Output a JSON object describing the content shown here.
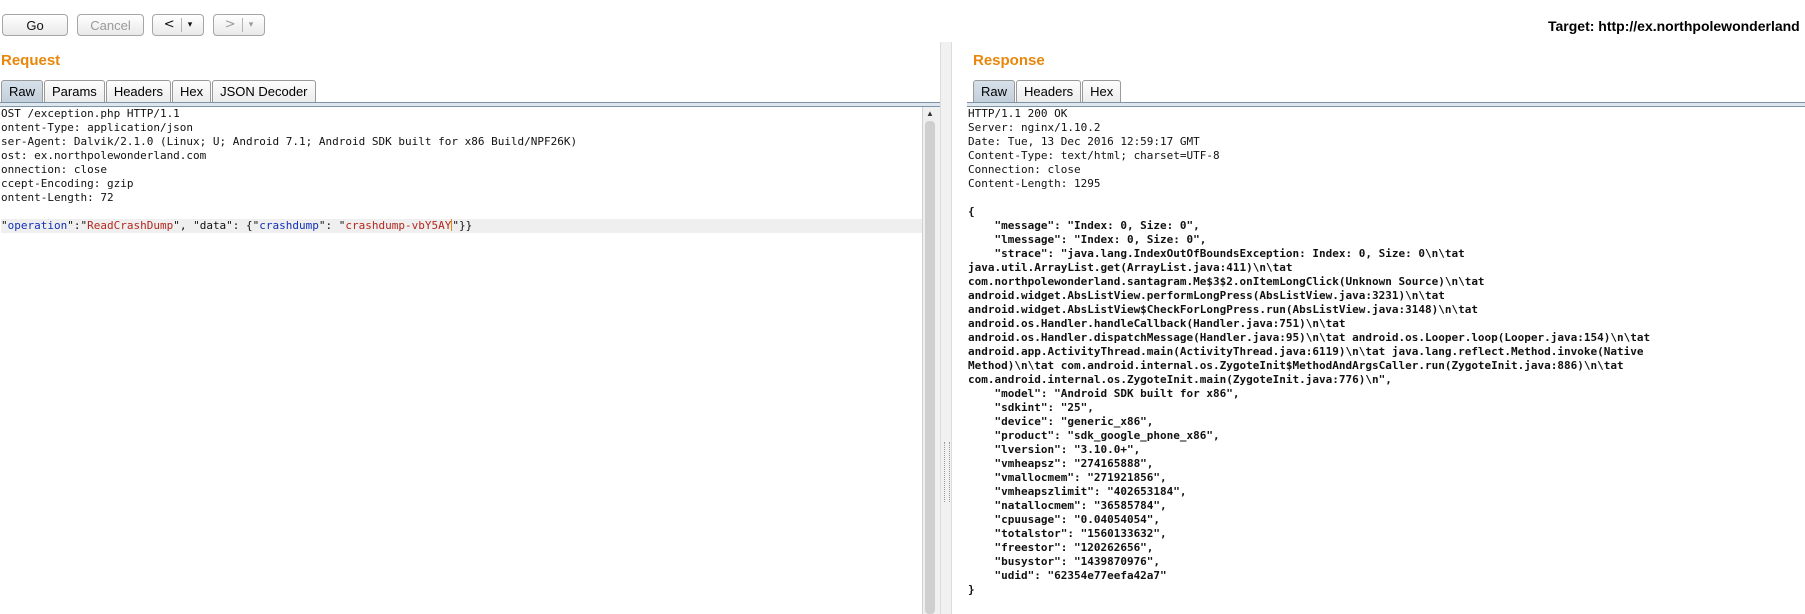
{
  "toolbar": {
    "go": "Go",
    "cancel": "Cancel",
    "prev": "<",
    "next": ">",
    "dropdown": "▾",
    "target": "Target: http://ex.northpolewonderland"
  },
  "request": {
    "title": "Request",
    "tabs": [
      "Raw",
      "Params",
      "Headers",
      "Hex",
      "JSON Decoder"
    ],
    "active_tab": "Raw",
    "lines": [
      "OST /exception.php HTTP/1.1",
      "ontent-Type: application/json",
      "ser-Agent: Dalvik/2.1.0 (Linux; U; Android 7.1; Android SDK built for x86 Build/NPF26K)",
      "ost: ex.northpolewonderland.com",
      "onnection: close",
      "ccept-Encoding: gzip",
      "ontent-Length: 72",
      ""
    ],
    "body": {
      "q1": "\"",
      "k1": "operation",
      "s1": "\":\"",
      "v1": "ReadCrashDump",
      "s2": "\", \"data\": {\"",
      "k2": "crashdump",
      "s3": "\": \"",
      "v2": "crashdump-vbY5AY",
      "s4": "\"}}"
    }
  },
  "response": {
    "title": "Response",
    "tabs": [
      "Raw",
      "Headers",
      "Hex"
    ],
    "active_tab": "Raw",
    "headers": [
      "HTTP/1.1 200 OK",
      "Server: nginx/1.10.2",
      "Date: Tue, 13 Dec 2016 12:59:17 GMT",
      "Content-Type: text/html; charset=UTF-8",
      "Connection: close",
      "Content-Length: 1295",
      ""
    ],
    "body_lines": [
      "{",
      "    \"message\": \"Index: 0, Size: 0\",",
      "    \"lmessage\": \"Index: 0, Size: 0\",",
      "    \"strace\": \"java.lang.IndexOutOfBoundsException: Index: 0, Size: 0\\n\\tat",
      "java.util.ArrayList.get(ArrayList.java:411)\\n\\tat",
      "com.northpolewonderland.santagram.Me$3$2.onItemLongClick(Unknown Source)\\n\\tat",
      "android.widget.AbsListView.performLongPress(AbsListView.java:3231)\\n\\tat",
      "android.widget.AbsListView$CheckForLongPress.run(AbsListView.java:3148)\\n\\tat",
      "android.os.Handler.handleCallback(Handler.java:751)\\n\\tat",
      "android.os.Handler.dispatchMessage(Handler.java:95)\\n\\tat android.os.Looper.loop(Looper.java:154)\\n\\tat",
      "android.app.ActivityThread.main(ActivityThread.java:6119)\\n\\tat java.lang.reflect.Method.invoke(Native",
      "Method)\\n\\tat com.android.internal.os.ZygoteInit$MethodAndArgsCaller.run(ZygoteInit.java:886)\\n\\tat",
      "com.android.internal.os.ZygoteInit.main(ZygoteInit.java:776)\\n\",",
      "    \"model\": \"Android SDK built for x86\",",
      "    \"sdkint\": \"25\",",
      "    \"device\": \"generic_x86\",",
      "    \"product\": \"sdk_google_phone_x86\",",
      "    \"lversion\": \"3.10.0+\",",
      "    \"vmheapsz\": \"274165888\",",
      "    \"vmallocmem\": \"271921856\",",
      "    \"vmheapszlimit\": \"402653184\",",
      "    \"natallocmem\": \"36585784\",",
      "    \"cpuusage\": \"0.04054054\",",
      "    \"totalstor\": \"1560133632\",",
      "    \"freestor\": \"120262656\",",
      "    \"busystor\": \"1439870976\",",
      "    \"udid\": \"62354e77eefa42a7\"",
      "}"
    ]
  }
}
